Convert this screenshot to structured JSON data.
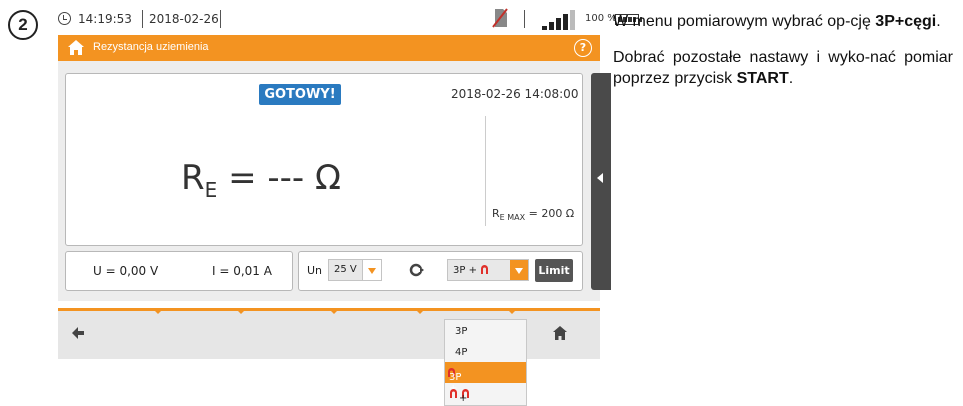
{
  "step": {
    "number": "2"
  },
  "status_bar": {
    "time": "14:19:53",
    "date": "2018-02-26",
    "battery_percent": "100 %",
    "signal_level": 4
  },
  "header": {
    "title": "Rezystancja uziemienia",
    "help": "?"
  },
  "measurement": {
    "state_badge": "GOTOWY!",
    "datetime": "2018-02-26 14:08:00",
    "result_label": "R",
    "result_sub": "E",
    "result_value": " = --- Ω",
    "max_label": "R",
    "max_sub": "E MAX",
    "max_value": " = 200 Ω"
  },
  "readings": {
    "voltage": "U = 0,00 V",
    "current": "I = 0,01 A"
  },
  "settings": {
    "un_label": "Un",
    "un_value": "25 V",
    "method_value": "3P +",
    "limit_label": "Limit"
  },
  "method_options": [
    {
      "label": "3P"
    },
    {
      "label": "4P"
    },
    {
      "label": "3P +",
      "selected": true
    },
    {
      "label": "+"
    }
  ],
  "instructions": {
    "p1_prefix": "W menu pomiarowym wybrać op-cję ",
    "p1_bold": "3P+cęgi",
    "p1_suffix": ".",
    "p2_prefix": "Dobrać pozostałe nastawy i wyko-nać pomiar poprzez przycisk ",
    "p2_bold": "START",
    "p2_suffix": "."
  },
  "colors": {
    "accent": "#f39321",
    "badge": "#2a7ac0",
    "clamp": "#e0302a"
  }
}
